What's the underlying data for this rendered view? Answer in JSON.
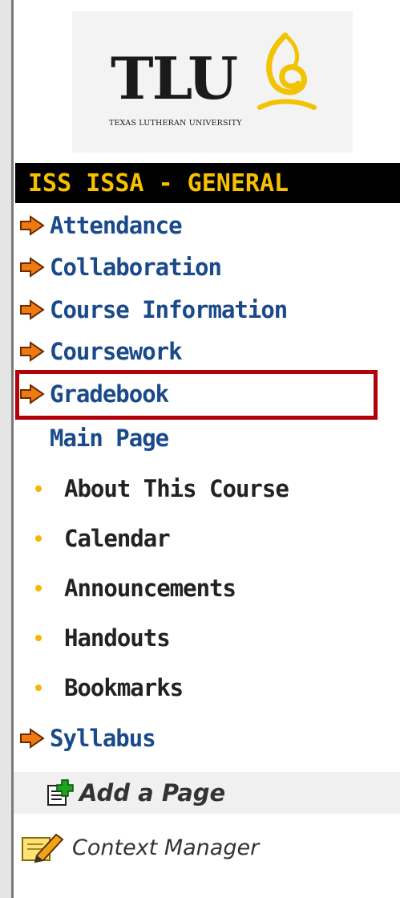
{
  "logo": {
    "letters": "TLU",
    "subtitle": "TEXAS LUTHERAN UNIVERSITY"
  },
  "course": {
    "title": "ISS ISSA - GENERAL"
  },
  "nav": {
    "items": [
      {
        "label": "Attendance"
      },
      {
        "label": "Collaboration"
      },
      {
        "label": "Course Information"
      },
      {
        "label": "Coursework"
      },
      {
        "label": "Gradebook"
      }
    ],
    "main_page": "Main Page",
    "sub_items": [
      {
        "label": "About This Course"
      },
      {
        "label": "Calendar"
      },
      {
        "label": "Announcements"
      },
      {
        "label": "Handouts"
      },
      {
        "label": "Bookmarks"
      }
    ],
    "syllabus": "Syllabus"
  },
  "tools": {
    "add_page": "Add a Page",
    "context_manager": "Context Manager"
  },
  "colors": {
    "header_bg": "#000000",
    "header_text": "#f7c000",
    "link": "#1a4a8a",
    "arrow": "#f07a12",
    "bullet": "#f5b700",
    "highlight": "#b3000a"
  },
  "icons": {
    "nav_arrow": "orange-arrow-icon",
    "bullet": "yellow-dot-icon",
    "add_page": "add-page-icon",
    "context_manager": "edit-pencil-icon"
  }
}
